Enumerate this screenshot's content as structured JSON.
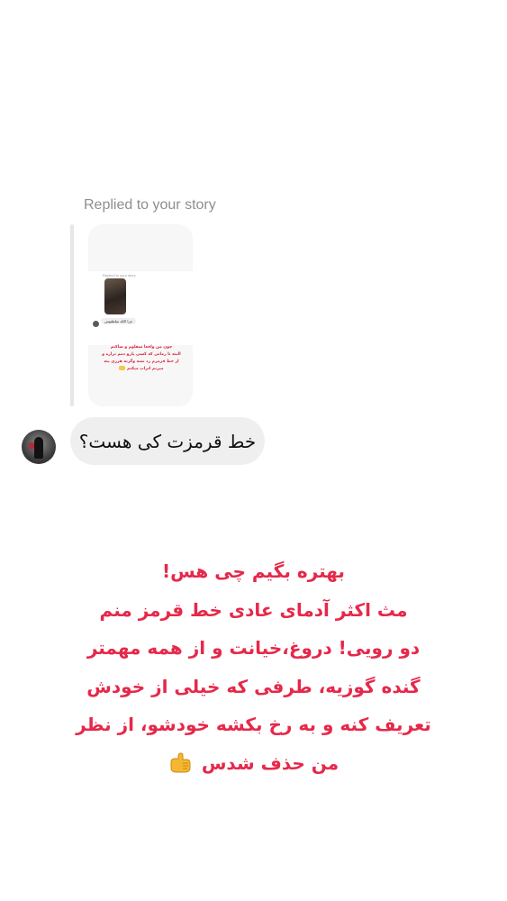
{
  "reply_header": "Replied to your story",
  "story_preview": {
    "label": "Replied to your story",
    "reply_text": "چرا الکه سلطنوس",
    "red_lines": [
      "چون من واقعا سقلوم و ساکتم",
      "البته تا زمانی که کسی پارو دمم نزاره و",
      "از خط قرمزم رد نشه وگرنه هرری پته",
      "میزنم اتراب میکنم"
    ],
    "emoji": "thumbs-emoji"
  },
  "message": {
    "text": "خط قرمزت کی هست؟",
    "avatar_icon": "profile-photo"
  },
  "caption": {
    "lines": [
      "بهتره بگیم چی هس!",
      "مث اکثر آدمای عادی خط قرمز منم",
      "دو رویی! دروغ،خیانت  و از همه مهمتر",
      "گنده گوزیه، طرفی که خیلی از خودش",
      "تعریف کنه و به رخ بکشه خودشو، از نظر",
      "من حذف شدس"
    ],
    "emoji_icon": "call-me-hand-icon",
    "color": "#e6284a"
  }
}
